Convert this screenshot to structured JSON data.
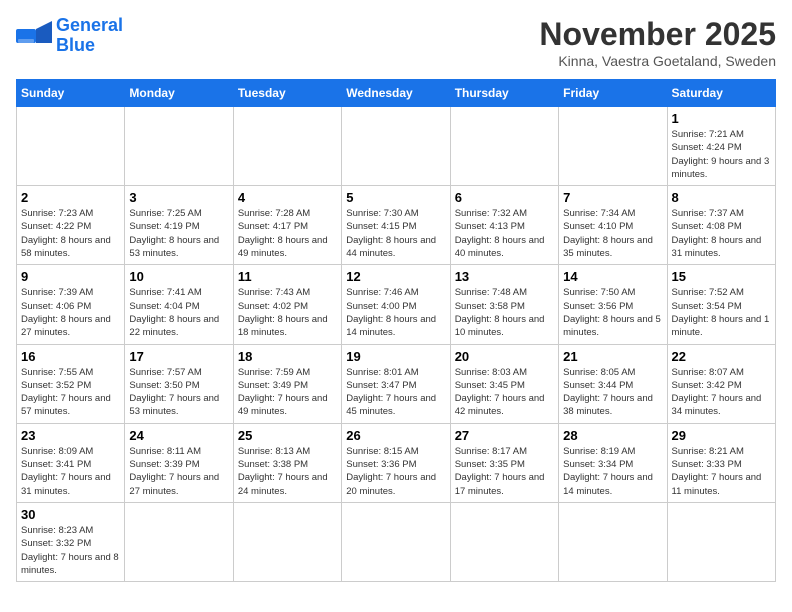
{
  "header": {
    "logo_general": "General",
    "logo_blue": "Blue",
    "month_title": "November 2025",
    "location": "Kinna, Vaestra Goetaland, Sweden"
  },
  "days_of_week": [
    "Sunday",
    "Monday",
    "Tuesday",
    "Wednesday",
    "Thursday",
    "Friday",
    "Saturday"
  ],
  "weeks": [
    [
      {
        "day": "",
        "info": ""
      },
      {
        "day": "",
        "info": ""
      },
      {
        "day": "",
        "info": ""
      },
      {
        "day": "",
        "info": ""
      },
      {
        "day": "",
        "info": ""
      },
      {
        "day": "",
        "info": ""
      },
      {
        "day": "1",
        "info": "Sunrise: 7:21 AM\nSunset: 4:24 PM\nDaylight: 9 hours\nand 3 minutes."
      }
    ],
    [
      {
        "day": "2",
        "info": "Sunrise: 7:23 AM\nSunset: 4:22 PM\nDaylight: 8 hours\nand 58 minutes."
      },
      {
        "day": "3",
        "info": "Sunrise: 7:25 AM\nSunset: 4:19 PM\nDaylight: 8 hours\nand 53 minutes."
      },
      {
        "day": "4",
        "info": "Sunrise: 7:28 AM\nSunset: 4:17 PM\nDaylight: 8 hours\nand 49 minutes."
      },
      {
        "day": "5",
        "info": "Sunrise: 7:30 AM\nSunset: 4:15 PM\nDaylight: 8 hours\nand 44 minutes."
      },
      {
        "day": "6",
        "info": "Sunrise: 7:32 AM\nSunset: 4:13 PM\nDaylight: 8 hours\nand 40 minutes."
      },
      {
        "day": "7",
        "info": "Sunrise: 7:34 AM\nSunset: 4:10 PM\nDaylight: 8 hours\nand 35 minutes."
      },
      {
        "day": "8",
        "info": "Sunrise: 7:37 AM\nSunset: 4:08 PM\nDaylight: 8 hours\nand 31 minutes."
      }
    ],
    [
      {
        "day": "9",
        "info": "Sunrise: 7:39 AM\nSunset: 4:06 PM\nDaylight: 8 hours\nand 27 minutes."
      },
      {
        "day": "10",
        "info": "Sunrise: 7:41 AM\nSunset: 4:04 PM\nDaylight: 8 hours\nand 22 minutes."
      },
      {
        "day": "11",
        "info": "Sunrise: 7:43 AM\nSunset: 4:02 PM\nDaylight: 8 hours\nand 18 minutes."
      },
      {
        "day": "12",
        "info": "Sunrise: 7:46 AM\nSunset: 4:00 PM\nDaylight: 8 hours\nand 14 minutes."
      },
      {
        "day": "13",
        "info": "Sunrise: 7:48 AM\nSunset: 3:58 PM\nDaylight: 8 hours\nand 10 minutes."
      },
      {
        "day": "14",
        "info": "Sunrise: 7:50 AM\nSunset: 3:56 PM\nDaylight: 8 hours\nand 5 minutes."
      },
      {
        "day": "15",
        "info": "Sunrise: 7:52 AM\nSunset: 3:54 PM\nDaylight: 8 hours\nand 1 minute."
      }
    ],
    [
      {
        "day": "16",
        "info": "Sunrise: 7:55 AM\nSunset: 3:52 PM\nDaylight: 7 hours\nand 57 minutes."
      },
      {
        "day": "17",
        "info": "Sunrise: 7:57 AM\nSunset: 3:50 PM\nDaylight: 7 hours\nand 53 minutes."
      },
      {
        "day": "18",
        "info": "Sunrise: 7:59 AM\nSunset: 3:49 PM\nDaylight: 7 hours\nand 49 minutes."
      },
      {
        "day": "19",
        "info": "Sunrise: 8:01 AM\nSunset: 3:47 PM\nDaylight: 7 hours\nand 45 minutes."
      },
      {
        "day": "20",
        "info": "Sunrise: 8:03 AM\nSunset: 3:45 PM\nDaylight: 7 hours\nand 42 minutes."
      },
      {
        "day": "21",
        "info": "Sunrise: 8:05 AM\nSunset: 3:44 PM\nDaylight: 7 hours\nand 38 minutes."
      },
      {
        "day": "22",
        "info": "Sunrise: 8:07 AM\nSunset: 3:42 PM\nDaylight: 7 hours\nand 34 minutes."
      }
    ],
    [
      {
        "day": "23",
        "info": "Sunrise: 8:09 AM\nSunset: 3:41 PM\nDaylight: 7 hours\nand 31 minutes."
      },
      {
        "day": "24",
        "info": "Sunrise: 8:11 AM\nSunset: 3:39 PM\nDaylight: 7 hours\nand 27 minutes."
      },
      {
        "day": "25",
        "info": "Sunrise: 8:13 AM\nSunset: 3:38 PM\nDaylight: 7 hours\nand 24 minutes."
      },
      {
        "day": "26",
        "info": "Sunrise: 8:15 AM\nSunset: 3:36 PM\nDaylight: 7 hours\nand 20 minutes."
      },
      {
        "day": "27",
        "info": "Sunrise: 8:17 AM\nSunset: 3:35 PM\nDaylight: 7 hours\nand 17 minutes."
      },
      {
        "day": "28",
        "info": "Sunrise: 8:19 AM\nSunset: 3:34 PM\nDaylight: 7 hours\nand 14 minutes."
      },
      {
        "day": "29",
        "info": "Sunrise: 8:21 AM\nSunset: 3:33 PM\nDaylight: 7 hours\nand 11 minutes."
      }
    ],
    [
      {
        "day": "30",
        "info": "Sunrise: 8:23 AM\nSunset: 3:32 PM\nDaylight: 7 hours\nand 8 minutes."
      },
      {
        "day": "",
        "info": ""
      },
      {
        "day": "",
        "info": ""
      },
      {
        "day": "",
        "info": ""
      },
      {
        "day": "",
        "info": ""
      },
      {
        "day": "",
        "info": ""
      },
      {
        "day": "",
        "info": ""
      }
    ]
  ]
}
